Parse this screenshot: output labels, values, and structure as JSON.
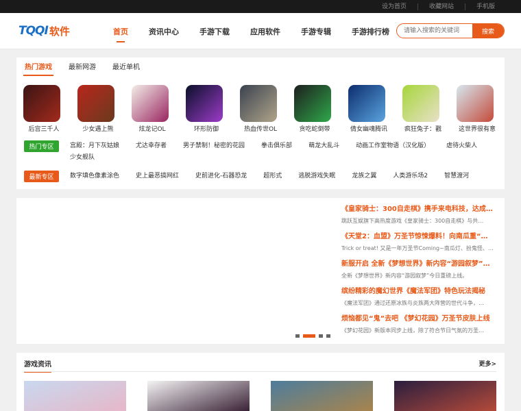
{
  "topbar": {
    "links": [
      "设为首页",
      "收藏网站",
      "手机版"
    ]
  },
  "header": {
    "logo_mark": "TQQI",
    "logo_text": "软件",
    "nav": [
      "首页",
      "资讯中心",
      "手游下载",
      "应用软件",
      "手游专辑",
      "手游排行榜"
    ],
    "active_nav": 0,
    "search": {
      "placeholder": "请输入搜索的关键词",
      "button": "搜索"
    }
  },
  "games_panel": {
    "tabs": [
      "热门游戏",
      "最新网游",
      "最近单机"
    ],
    "active_tab": 0,
    "games": [
      {
        "name": "后宫三千人",
        "colors": [
          "#3b1414",
          "#a22a1c"
        ]
      },
      {
        "name": "少女遇上熊",
        "colors": [
          "#b8261c",
          "#6a3a1e"
        ]
      },
      {
        "name": "炫龙记OL",
        "colors": [
          "#f3efe9",
          "#9a2460"
        ]
      },
      {
        "name": "环形防御",
        "colors": [
          "#0a0f2a",
          "#9c3cc8"
        ]
      },
      {
        "name": "热血传世OL",
        "colors": [
          "#3a4250",
          "#b0a48a"
        ]
      },
      {
        "name": "贪吃蛇倒带",
        "colors": [
          "#1e1e1e",
          "#2ea84a"
        ]
      },
      {
        "name": "倩女幽魂腾讯",
        "colors": [
          "#0c2c6c",
          "#5aa4e0"
        ]
      },
      {
        "name": "疯狂兔子：戳",
        "colors": [
          "#a6d63a",
          "#e8e0c8"
        ]
      },
      {
        "name": "这世界很有意",
        "colors": [
          "#d6e8f0",
          "#c44a3a"
        ]
      }
    ],
    "zones": [
      {
        "label": "热门专区",
        "color": "#2fa52f",
        "links": [
          "宫殿：月下灰姑娘",
          "尤达幸存者",
          "男子禁制！秘密的花园",
          "拳击俱乐部",
          "萌龙大乱斗",
          "动画工作室物语（汉化版）",
          "虐待火柴人",
          "少女舰队"
        ]
      },
      {
        "label": "最新专区",
        "color": "#e85a1a",
        "links": [
          "数字填色像素涂色",
          "史上最恶搞网红",
          "史前进化-石器恐龙",
          "超形式",
          "逃脱游戏失眠",
          "龙族之翼",
          "人类游乐场2",
          "智慧渡河"
        ]
      }
    ]
  },
  "news_panel": {
    "items": [
      {
        "title": "《皇家骑士：300自走棋》携手来电科技，达成…",
        "desc": "跳跃互娱旗下高热度游戏《皇家骑士：300自走棋》与共…"
      },
      {
        "title": "《天堂2：血盟》万圣节惊悚爆料！向南瓜重“…",
        "desc": "Trick or treat! 又是一年万圣节Coming~南瓜灯、扮鬼怪、…"
      },
      {
        "title": "新服开启 全新《梦想世界》新内容“游园叙梦”…",
        "desc": "全新《梦想世界》新内容“游园叙梦”今日重磅上线。"
      },
      {
        "title": "缤纷精彩的魔幻世界《魔法军团》特色玩法揭秘",
        "desc": "《魔法军团》通过还原冰族与炎族两大阵营的世代斗争，…"
      },
      {
        "title": "烦恼都见“鬼”去吧 《梦幻花园》万圣节皮肤上线",
        "desc": "《梦幻花园》新版本同步上线，除了符合节日气氛的万圣…"
      }
    ],
    "dots": 4,
    "active_dot": 1
  },
  "info_panel": {
    "title": "游戏资讯",
    "more": "更多>",
    "thumbs": [
      {
        "colors": [
          "#c9d8ef",
          "#e6b7c8"
        ]
      },
      {
        "colors": [
          "#f4f4f4",
          "#3a2236"
        ]
      },
      {
        "colors": [
          "#4d7d9d",
          "#a8844c"
        ]
      },
      {
        "colors": [
          "#2a1e3e",
          "#b44a3a"
        ]
      }
    ]
  }
}
